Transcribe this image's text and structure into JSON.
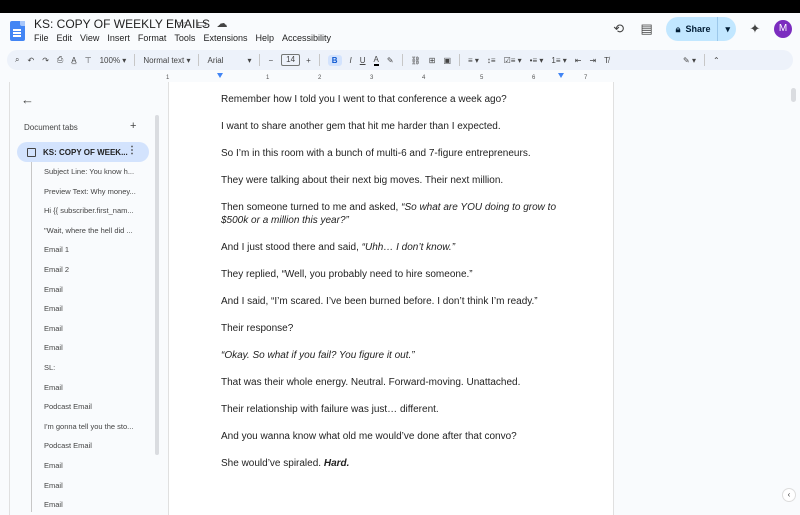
{
  "document": {
    "title": "KS: COPY OF WEEKLY EMAILS"
  },
  "menu": [
    "File",
    "Edit",
    "View",
    "Insert",
    "Format",
    "Tools",
    "Extensions",
    "Help",
    "Accessibility"
  ],
  "header": {
    "share_label": "Share",
    "avatar_initial": "M"
  },
  "toolbar": {
    "zoom": "100%",
    "style": "Normal text",
    "font": "Arial",
    "font_size": "14",
    "bold_label": "B",
    "italic_label": "I",
    "underline_label": "U",
    "text_color_label": "A"
  },
  "ruler": {
    "ticks": [
      "1",
      "1",
      "2",
      "3",
      "4",
      "5",
      "6",
      "7"
    ]
  },
  "sidebar": {
    "tabs_heading": "Document tabs",
    "main_tab": "KS: COPY OF WEEK...",
    "outline": [
      "Subject Line: You know h...",
      "Preview Text: Why money...",
      "Hi {{ subscriber.first_nam...",
      "\"Wait, where the hell did ...",
      "Email 1",
      "Email 2",
      "Email",
      "Email",
      "Email",
      "Email",
      "SL:",
      "Email",
      "Podcast Email",
      "I'm gonna tell you the sto...",
      "Podcast Email",
      "Email",
      "Email",
      "Email"
    ]
  },
  "body": [
    {
      "text": "Remember how I told you I went to that conference a week ago?"
    },
    {
      "text": "I want to share another gem that hit me harder than I expected."
    },
    {
      "text": "So I’m in this room with a bunch of multi-6 and 7-figure entrepreneurs."
    },
    {
      "text": "They were talking about their next big moves. Their next million."
    },
    {
      "text": "Then someone turned to me and asked, ",
      "em": "“So what are YOU doing to grow to $500k or a million this year?”"
    },
    {
      "text": "And I just stood there and said, ",
      "em": "“Uhh… I don’t know.”"
    },
    {
      "text": "They replied, “Well, you probably need to hire someone.”"
    },
    {
      "text": "And I said, “I’m scared. I’ve been burned before. I don’t think I’m ready.”"
    },
    {
      "text": "Their response?"
    },
    {
      "text": "",
      "em": "“Okay. So what if you fail? You figure it out.”"
    },
    {
      "text": "That was their whole energy. Neutral. Forward-moving. Unattached."
    },
    {
      "text": "Their relationship with failure was just… different."
    },
    {
      "text": "And you wanna know what old me would’ve done after that convo?"
    },
    {
      "text": "She would’ve spiraled. ",
      "strong": "Hard."
    }
  ]
}
